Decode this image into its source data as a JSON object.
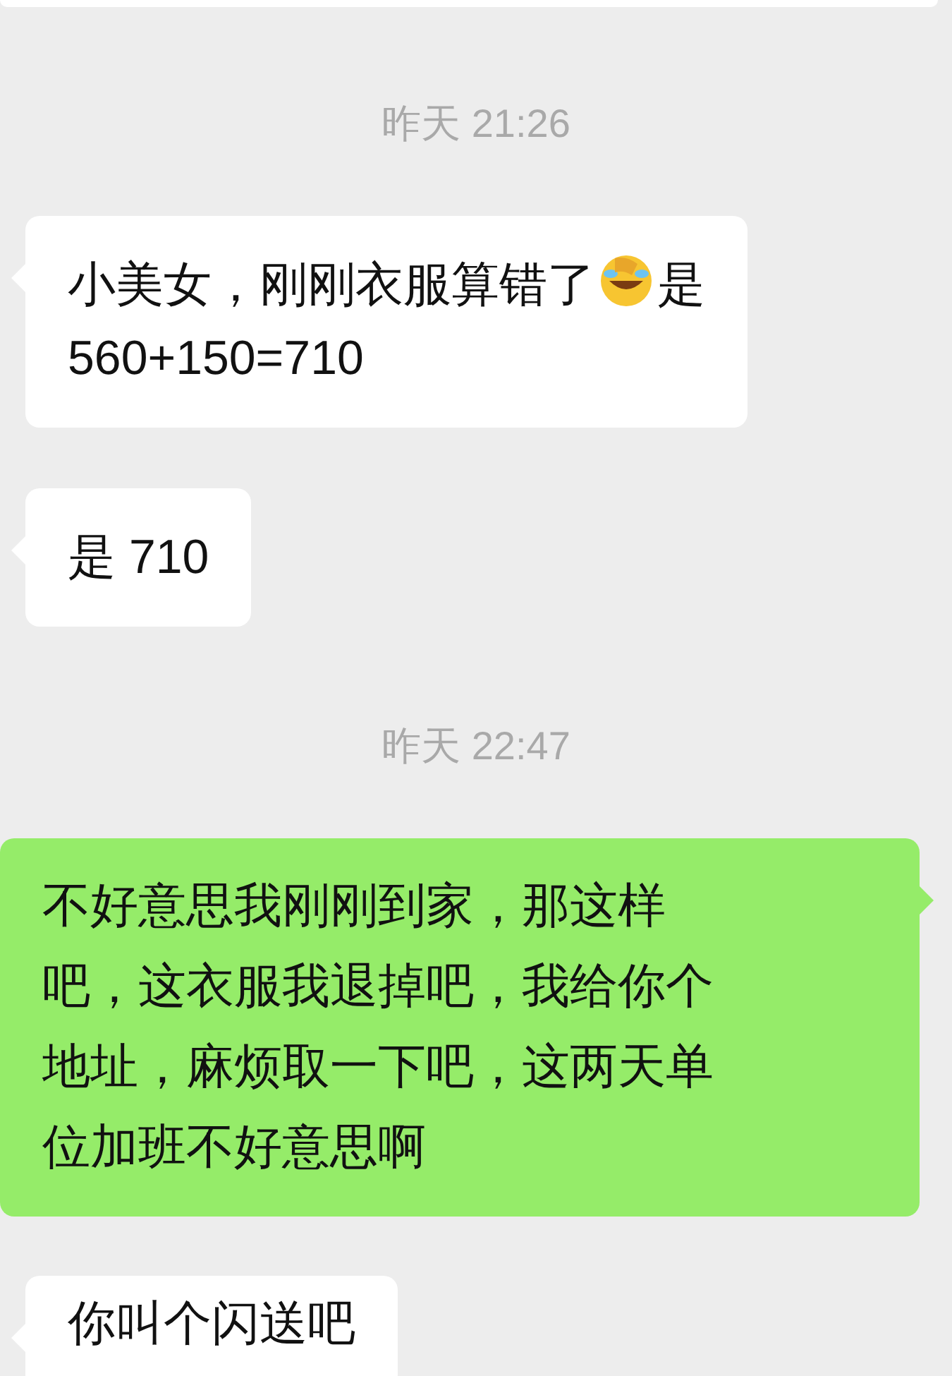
{
  "messages": [
    {
      "kind": "clipped_bubble"
    },
    {
      "kind": "timestamp",
      "text": "昨天 21:26"
    },
    {
      "kind": "incoming",
      "lines": [
        [
          {
            "kind": "text",
            "text": "小美女，刚刚衣服算错了"
          },
          {
            "kind": "emoji"
          },
          {
            "kind": "text",
            "text": "是"
          }
        ],
        [
          {
            "kind": "text",
            "text": "560+150=710"
          }
        ]
      ]
    },
    {
      "kind": "incoming",
      "lines": [
        [
          {
            "kind": "text",
            "text": "是 710"
          }
        ]
      ]
    },
    {
      "kind": "timestamp",
      "text": "昨天 22:47"
    },
    {
      "kind": "outgoing",
      "lines": [
        [
          {
            "kind": "text",
            "text": "不好意思我刚刚到家，那这样"
          }
        ],
        [
          {
            "kind": "text",
            "text": "吧，这衣服我退掉吧，我给你个"
          }
        ],
        [
          {
            "kind": "text",
            "text": "地址，麻烦取一下吧，这两天单"
          }
        ],
        [
          {
            "kind": "text",
            "text": "位加班不好意思啊"
          }
        ]
      ]
    },
    {
      "kind": "incoming",
      "lines": [
        [
          {
            "kind": "text",
            "text": "你叫个闪送吧"
          }
        ]
      ]
    }
  ]
}
